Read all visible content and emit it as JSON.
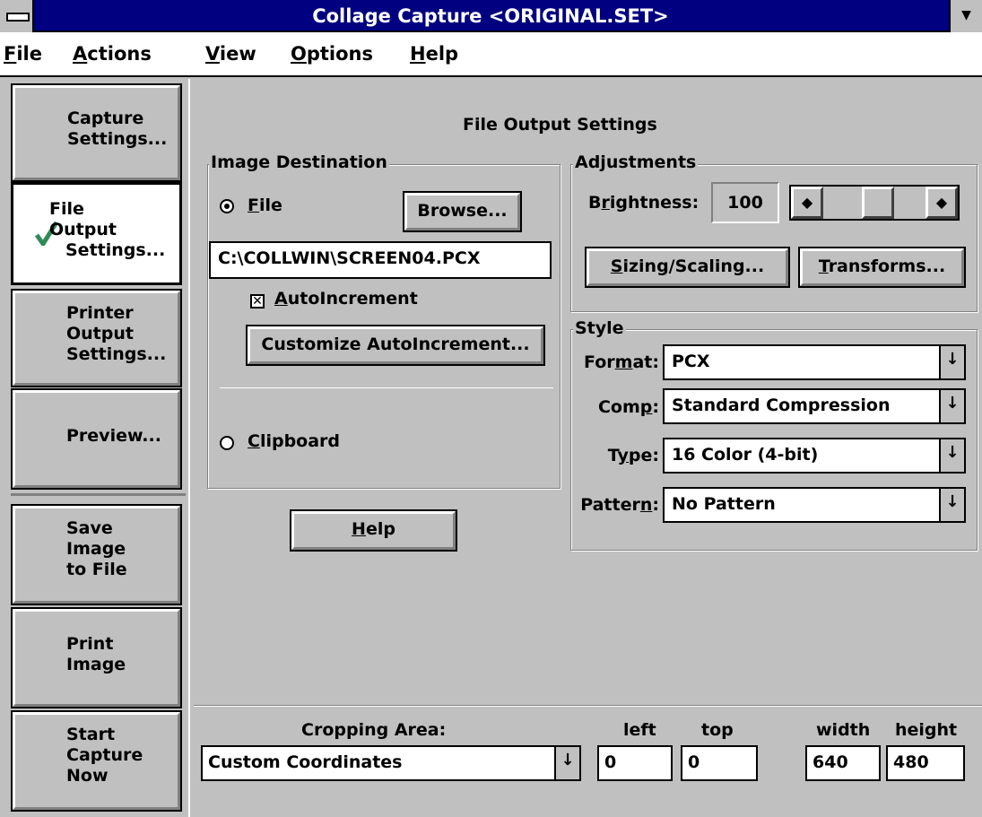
{
  "window": {
    "title": "Collage Capture <ORIGINAL.SET>"
  },
  "menu": [
    "File",
    "Actions",
    "View",
    "Options",
    "Help"
  ],
  "sidebar": {
    "capture": [
      "Capture",
      "Settings..."
    ],
    "file_output": [
      "File",
      "Output",
      "Settings..."
    ],
    "printer_output": [
      "Printer",
      "Output",
      "Settings..."
    ],
    "preview": "Preview...",
    "save_image": [
      "Save",
      "Image",
      "to File"
    ],
    "print_image": [
      "Print",
      "Image"
    ],
    "start_capture": [
      "Start",
      "Capture",
      "Now"
    ]
  },
  "panel": {
    "title": "File Output Settings"
  },
  "image_destination": {
    "title": "Image Destination",
    "file_label": "File",
    "browse": "Browse...",
    "path": "C:\\COLLWIN\\SCREEN04.PCX",
    "autoincrement_label": "AutoIncrement",
    "autoincrement_checked": true,
    "customize": "Customize AutoIncrement...",
    "clipboard_label": "Clipboard",
    "selected": "File"
  },
  "help_button": "Help",
  "adjustments": {
    "title": "Adjustments",
    "brightness_label": "Brightness:",
    "brightness_value": "100",
    "brightness_slider_fraction": 0.55,
    "sizing": "Sizing/Scaling...",
    "transforms": "Transforms..."
  },
  "style": {
    "title": "Style",
    "format_label": "Format:",
    "format_value": "PCX",
    "comp_label": "Comp:",
    "comp_value": "Standard Compression",
    "type_label": "Type:",
    "type_value": "16 Color (4-bit)",
    "pattern_label": "Pattern:",
    "pattern_value": "No Pattern"
  },
  "cropping": {
    "label": "Cropping Area:",
    "value": "Custom Coordinates",
    "left_label": "left",
    "top_label": "top",
    "width_label": "width",
    "height_label": "height",
    "left": "0",
    "top": "0",
    "width": "640",
    "height": "480"
  },
  "icons": {
    "check": "checkmark-icon",
    "combo": "down-arrow-icon"
  },
  "colors": {
    "titlebar": "#000080",
    "face": "#c0c0c0",
    "check": "#2e8b57"
  }
}
